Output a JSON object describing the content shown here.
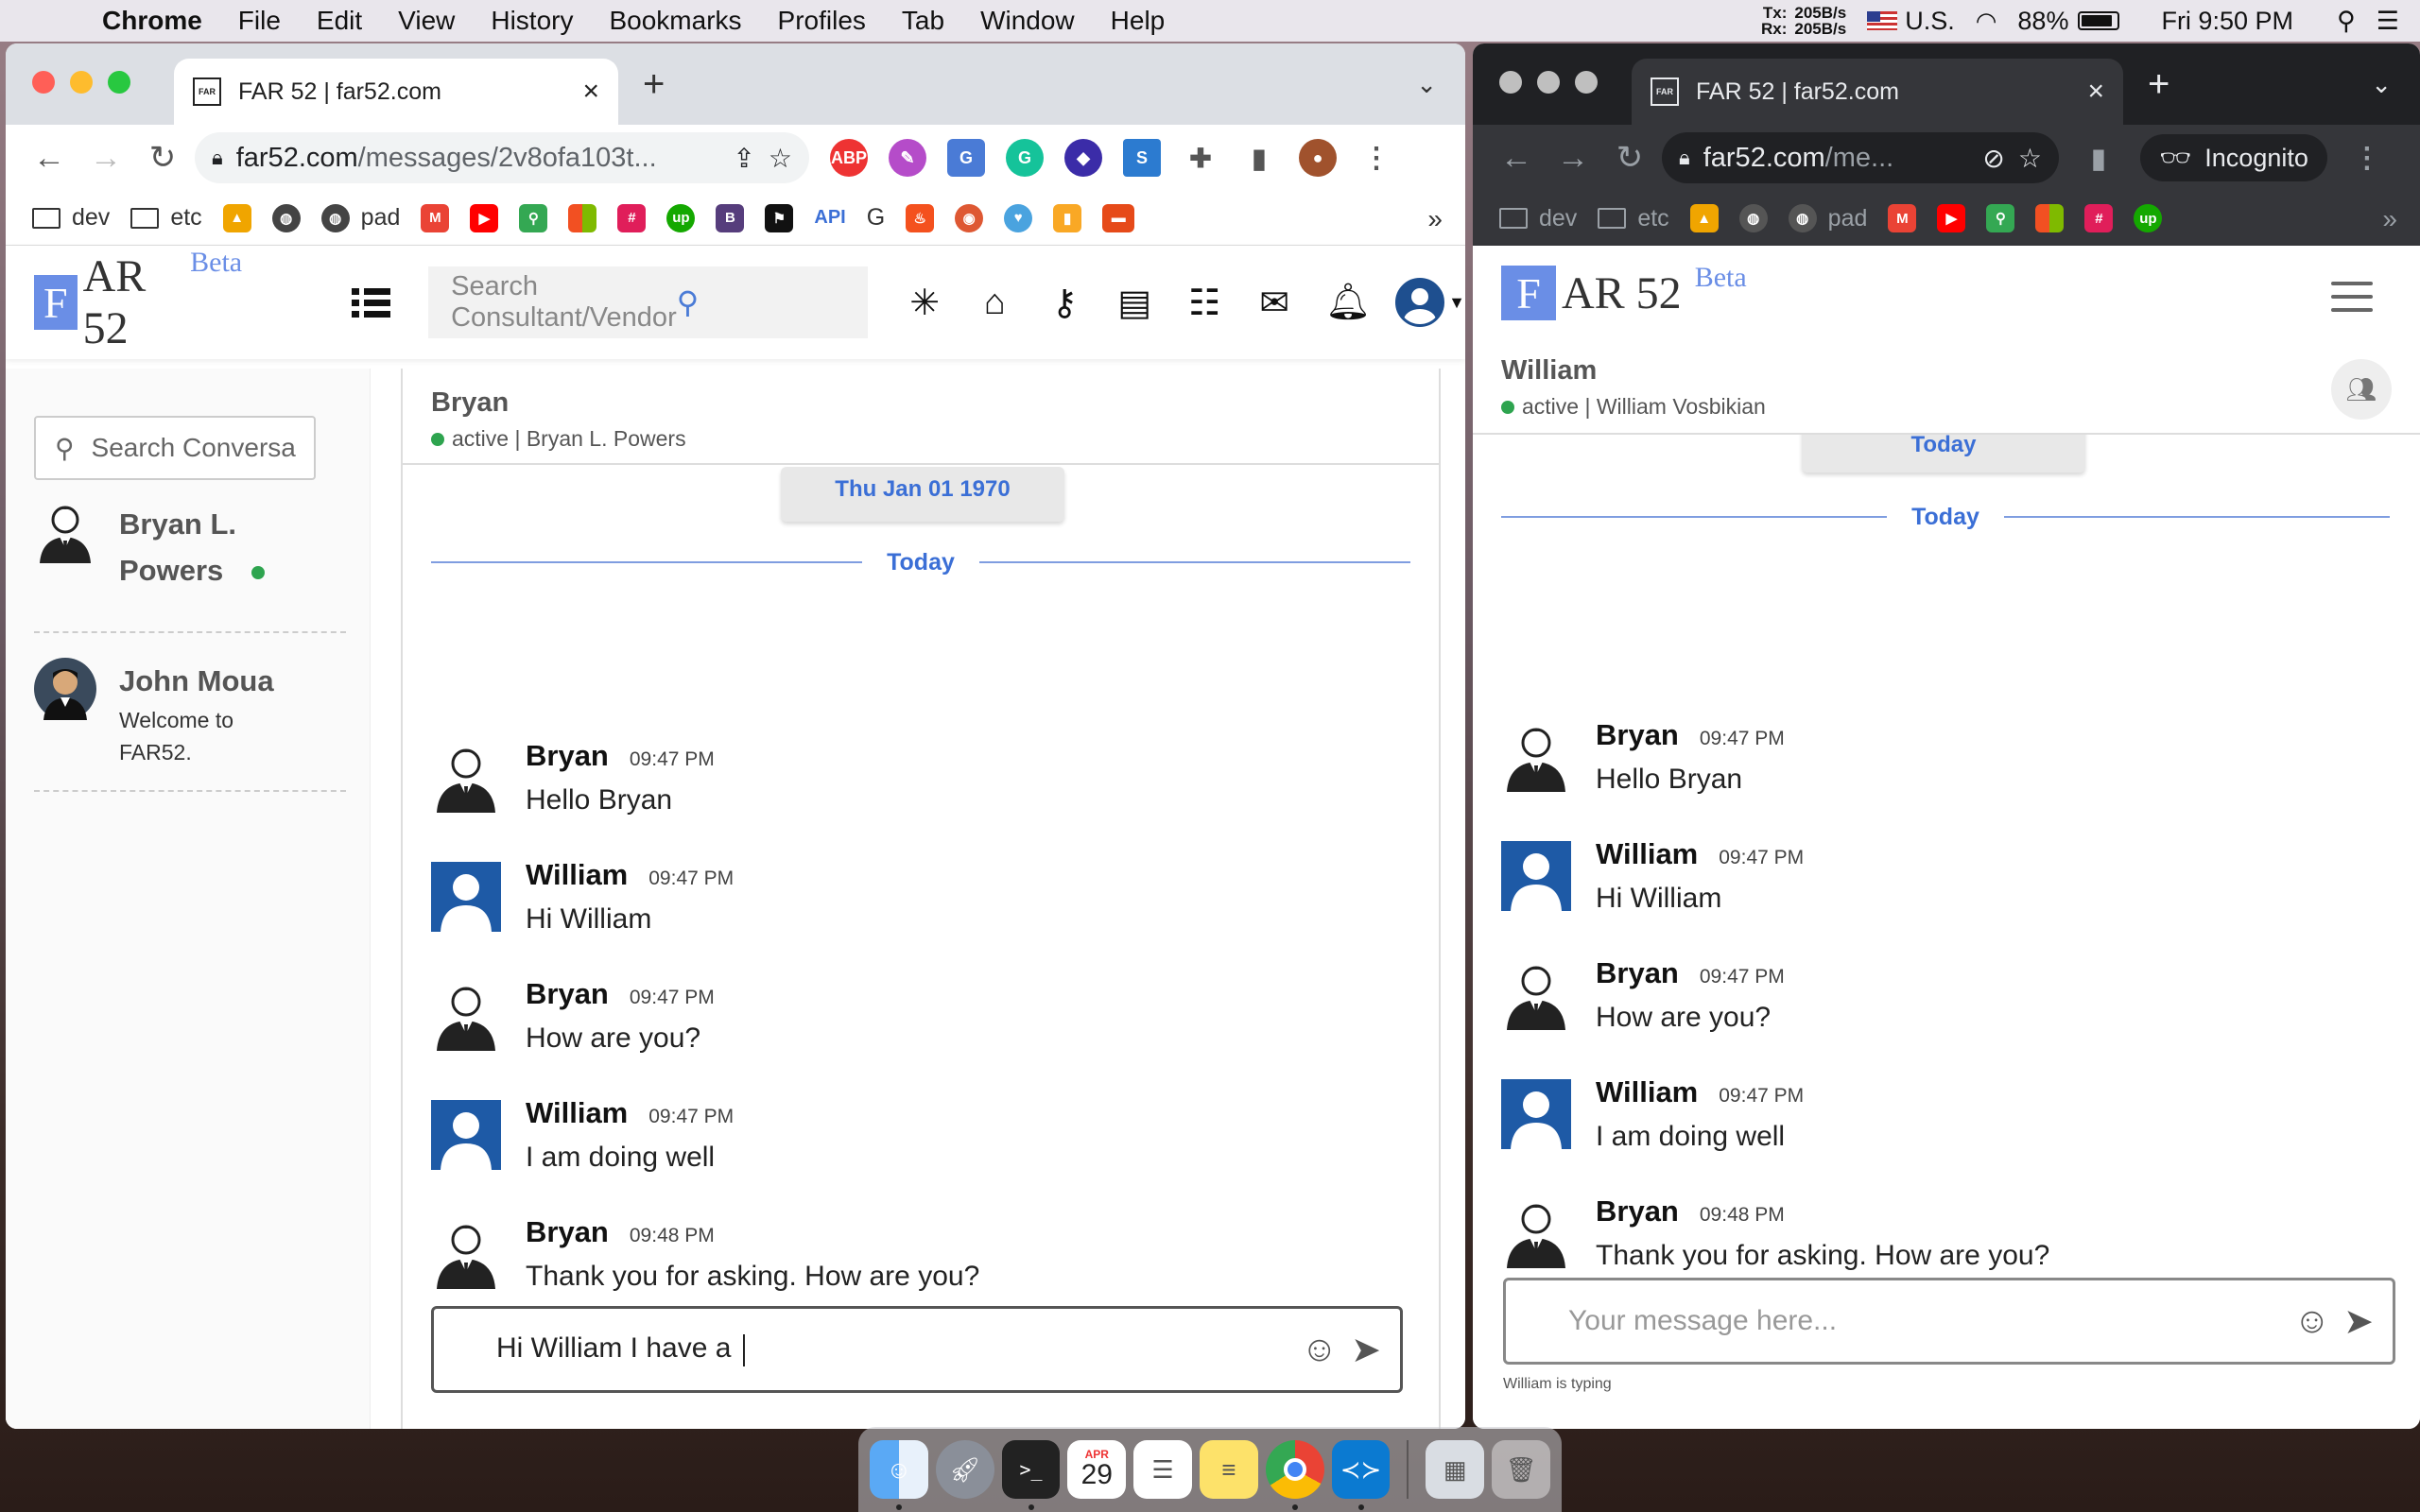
{
  "menubar": {
    "app_name": "Chrome",
    "items": [
      "File",
      "Edit",
      "View",
      "History",
      "Bookmarks",
      "Profiles",
      "Tab",
      "Window",
      "Help"
    ],
    "net_tx_label": "Tx:",
    "net_tx_value": "205B/s",
    "net_rx_label": "Rx:",
    "net_rx_value": "205B/s",
    "input_source": "U.S.",
    "battery_percent": "88%",
    "battery_level": 0.88,
    "clock": "Fri 9:50 PM"
  },
  "window_left": {
    "tab_title": "FAR 52 | far52.com",
    "url_host": "far52.com",
    "url_path": "/messages/2v8ofa103t...",
    "bookmarks": [
      "dev",
      "etc",
      "pad",
      "API",
      "G"
    ],
    "app": {
      "logo_letter": "F",
      "logo_text": "AR 52",
      "logo_badge": "Beta",
      "search_placeholder": "Search Consultant/Vendor"
    },
    "conversations": {
      "search_placeholder": "Search Conversa",
      "items": [
        {
          "name_line1": "Bryan L.",
          "name_line2": "Powers",
          "online": true
        },
        {
          "name": "John Moua",
          "preview_line1": "Welcome to",
          "preview_line2": "FAR52."
        }
      ]
    },
    "chat": {
      "header_name": "Bryan",
      "header_status": "active | Bryan L. Powers",
      "date_chip": "Thu Jan 01 1970",
      "today_label": "Today",
      "messages": [
        {
          "sender": "Bryan",
          "time": "09:47 PM",
          "text": "Hello Bryan",
          "avatar": "suit"
        },
        {
          "sender": "William",
          "time": "09:47 PM",
          "text": "Hi William",
          "avatar": "blue"
        },
        {
          "sender": "Bryan",
          "time": "09:47 PM",
          "text": "How are you?",
          "avatar": "suit"
        },
        {
          "sender": "William",
          "time": "09:47 PM",
          "text": "I am doing well",
          "avatar": "blue"
        },
        {
          "sender": "Bryan",
          "time": "09:48 PM",
          "text": "Thank you for asking. How are you?",
          "avatar": "suit"
        }
      ],
      "composer_value": "Hi William I have a "
    }
  },
  "window_right": {
    "tab_title": "FAR 52 | far52.com",
    "url_host": "far52.com",
    "url_path": "/me...",
    "incognito_label": "Incognito",
    "bookmarks": [
      "dev",
      "etc",
      "pad"
    ],
    "app": {
      "logo_letter": "F",
      "logo_text": "AR 52",
      "logo_badge": "Beta"
    },
    "chat": {
      "header_name": "William",
      "header_status": "active | William Vosbikian",
      "date_chip": "Today",
      "today_label": "Today",
      "messages": [
        {
          "sender": "Bryan",
          "time": "09:47 PM",
          "text": "Hello Bryan",
          "avatar": "suit"
        },
        {
          "sender": "William",
          "time": "09:47 PM",
          "text": "Hi William",
          "avatar": "blue"
        },
        {
          "sender": "Bryan",
          "time": "09:47 PM",
          "text": "How are you?",
          "avatar": "suit"
        },
        {
          "sender": "William",
          "time": "09:47 PM",
          "text": "I am doing well",
          "avatar": "blue"
        },
        {
          "sender": "Bryan",
          "time": "09:48 PM",
          "text": "Thank you for asking. How are you?",
          "avatar": "suit"
        }
      ],
      "composer_placeholder": "Your message here...",
      "typing_indicator": "William is typing"
    }
  },
  "dock": {
    "apps": [
      "finder-icon",
      "launchpad-icon",
      "terminal-icon",
      "calendar-icon",
      "reminders-icon",
      "notes-icon",
      "chrome-icon",
      "vscode-icon",
      "preview-icon",
      "trash-icon"
    ],
    "calendar_month": "APR",
    "calendar_day": "29"
  },
  "colors": {
    "brand_blue": "#6a8ee6",
    "link_blue": "#3b6fd6",
    "online_green": "#2ea44f"
  }
}
